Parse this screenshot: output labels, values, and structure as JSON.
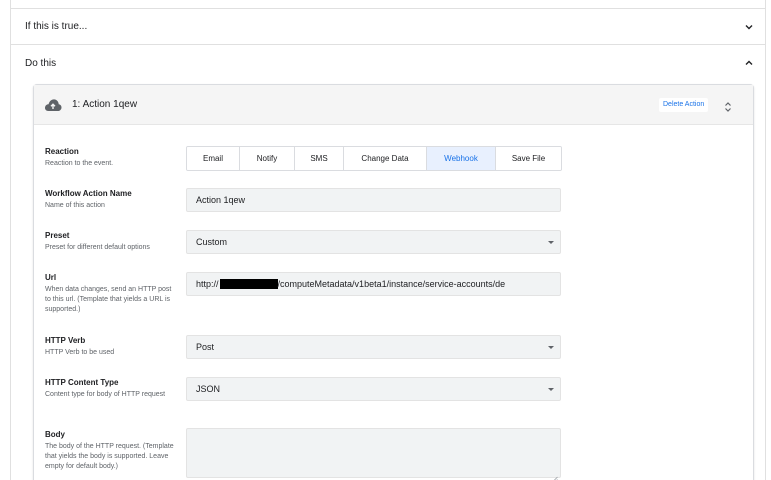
{
  "conditions": {
    "label": "If this is true..."
  },
  "actions_section": {
    "label": "Do this"
  },
  "action_card": {
    "title": "1: Action 1qew",
    "delete_label": "Delete Action"
  },
  "reaction": {
    "label": "Reaction",
    "help": "Reaction to the event.",
    "options": [
      "Email",
      "Notify",
      "SMS",
      "Change Data",
      "Webhook",
      "Save File"
    ],
    "selected": "Webhook"
  },
  "workflow_action_name": {
    "label": "Workflow Action Name",
    "help": "Name of this action",
    "value": "Action 1qew"
  },
  "preset": {
    "label": "Preset",
    "help": "Preset for different default options",
    "value": "Custom"
  },
  "url": {
    "label": "Url",
    "help": "When data changes, send an HTTP post to this url. (Template that yields a URL is supported.)",
    "value_prefix": "http://",
    "value_suffix": "/computeMetadata/v1beta1/instance/service-accounts/de"
  },
  "http_verb": {
    "label": "HTTP Verb",
    "help": "HTTP Verb to be used",
    "value": "Post"
  },
  "http_content_type": {
    "label": "HTTP Content Type",
    "help": "Content type for body of HTTP request",
    "value": "JSON"
  },
  "body": {
    "label": "Body",
    "help": "The body of the HTTP request. (Template that yields the body is supported. Leave empty for default body.)",
    "value": ""
  },
  "colors": {
    "accent": "#1a73e8",
    "selected_bg": "#e8f0fe",
    "input_bg": "#f1f3f4"
  },
  "icons": [
    "chevron-down-icon",
    "chevron-up-icon",
    "cloud-upload-icon",
    "unfold-icon",
    "dropdown-arrow-icon",
    "resize-grip-icon"
  ]
}
